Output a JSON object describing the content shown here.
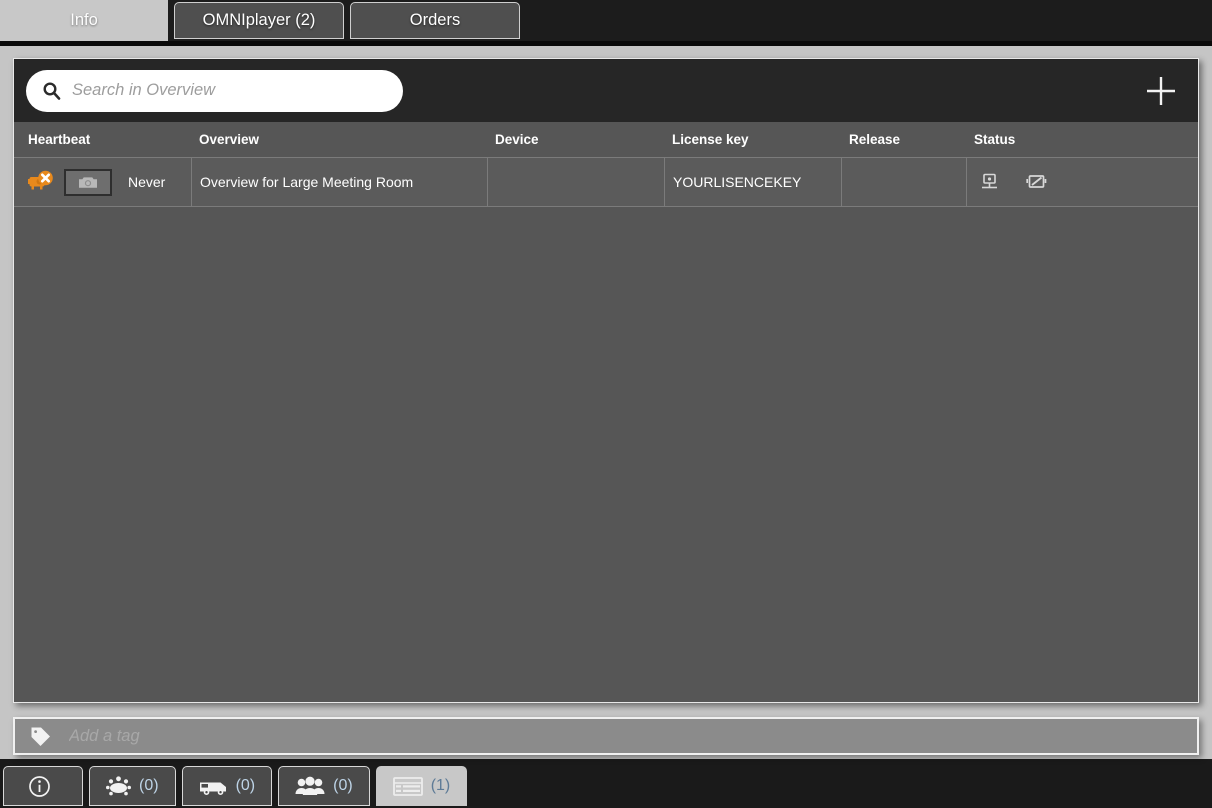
{
  "top_tabs": [
    {
      "label": "Info",
      "active": true
    },
    {
      "label": "OMNIplayer (2)",
      "active": false
    },
    {
      "label": "Orders",
      "active": false
    }
  ],
  "search": {
    "placeholder": "Search in Overview",
    "value": "",
    "icon": "search-icon"
  },
  "add_button": {
    "icon": "plus-icon",
    "label": ""
  },
  "table": {
    "columns": [
      "Heartbeat",
      "Overview",
      "Device",
      "License key",
      "Release",
      "Status"
    ],
    "rows": [
      {
        "heartbeat_icon": "projector-offline-icon",
        "screenshot_icon": "camera-icon",
        "heartbeat": "Never",
        "overview": "Overview for Large Meeting Room",
        "device": "",
        "license_key": "YOURLISENCEKEY",
        "release": "",
        "status_icons": [
          "display-icon",
          "screen-off-icon"
        ]
      }
    ]
  },
  "tag_bar": {
    "icon": "tag-icon",
    "placeholder": "Add a tag",
    "value": ""
  },
  "bottom_bar": [
    {
      "icon": "info-icon",
      "count": "",
      "selected": false
    },
    {
      "icon": "meeting-room-icon",
      "count": "(0)",
      "selected": false
    },
    {
      "icon": "van-icon",
      "count": "(0)",
      "selected": false
    },
    {
      "icon": "people-icon",
      "count": "(0)",
      "selected": false
    },
    {
      "icon": "list-icon",
      "count": "(1)",
      "selected": true
    }
  ],
  "colors": {
    "page_bg": "#c5c5c5",
    "dark_bg": "#1c1c1c",
    "card_bg": "#565656",
    "header_bg": "#262626",
    "accent_orange": "#e8891c",
    "count_blue": "#bdd3e6"
  }
}
